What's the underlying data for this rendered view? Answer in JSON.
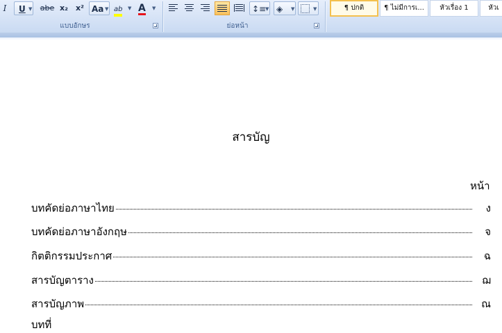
{
  "ribbon": {
    "font_group": {
      "label": "แบบอักษร",
      "italic": "I",
      "underline": "U",
      "strike": "abe",
      "subscript": "x₂",
      "superscript": "x²",
      "change_case": "Aa",
      "highlight": "ab",
      "font_color": "A"
    },
    "paragraph_group": {
      "label": "ย่อหน้า"
    },
    "styles": [
      {
        "label": "¶ ปกติ",
        "selected": true
      },
      {
        "label": "¶ ไม่มีการเ...",
        "selected": false
      },
      {
        "label": "หัวเรื่อง 1",
        "selected": false
      },
      {
        "label": "หัวเ",
        "selected": false
      }
    ]
  },
  "document": {
    "title": "สารบัญ",
    "page_header": "หน้า",
    "toc": [
      {
        "label": "บทคัดย่อภาษาไทย",
        "page": "ง"
      },
      {
        "label": "บทคัดย่อภาษาอังกฤษ",
        "page": "จ"
      },
      {
        "label": "กิตติกรรมประกาศ",
        "page": "ฉ"
      },
      {
        "label": "สารบัญตาราง",
        "page": "ฌ"
      },
      {
        "label": "สารบัญภาพ",
        "page": "ณ"
      }
    ],
    "cut_off_line": "บทที่"
  },
  "colors": {
    "ribbon_bg": "#d6e3f6",
    "highlight_yellow": "#ffff00",
    "font_color_red": "#e8141c",
    "active_button": "#f8c05c"
  }
}
